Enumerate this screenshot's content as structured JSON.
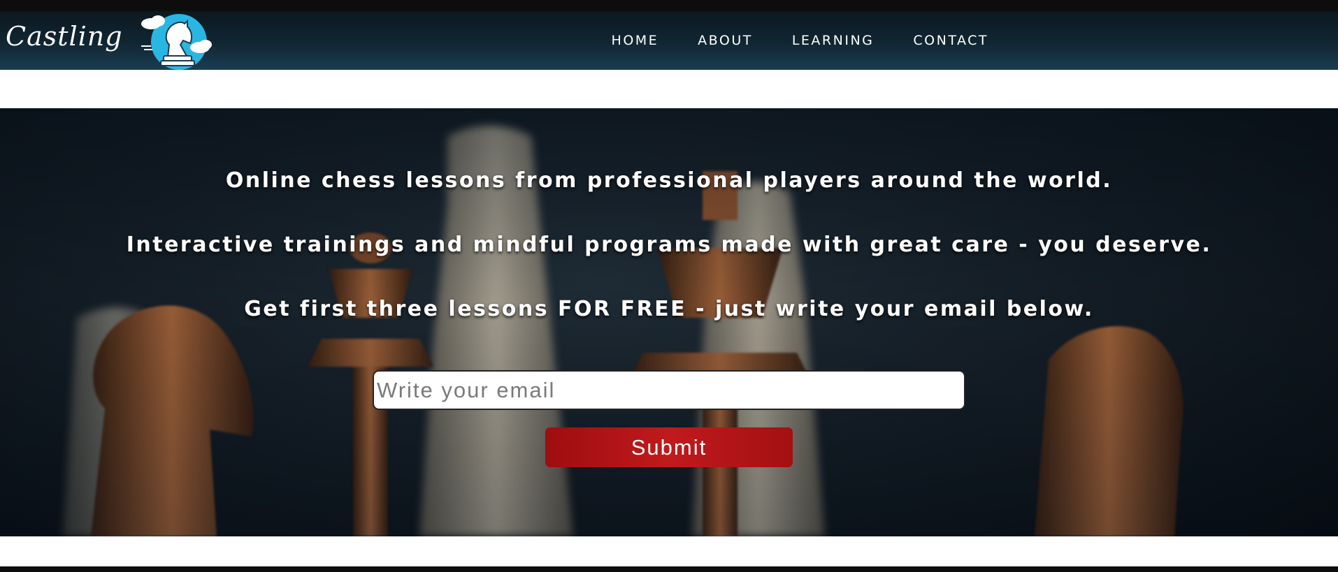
{
  "brand": {
    "name": "Castling",
    "emblem_icon": "cloud-knight-icon"
  },
  "nav": {
    "items": [
      {
        "label": "HOME"
      },
      {
        "label": "ABOUT"
      },
      {
        "label": "LEARNING"
      },
      {
        "label": "CONTACT"
      }
    ]
  },
  "hero": {
    "line1": "Online chess lessons from professional players around the world.",
    "line2": "Interactive trainings and mindful programs made with great care - you deserve.",
    "line3": "Get first three lessons FOR FREE - just write your email below.",
    "background": "chess-pieces-photo",
    "email": {
      "placeholder": "Write your email",
      "value": ""
    },
    "submit_label": "Submit"
  },
  "colors": {
    "header": "#112633",
    "submit": "#b31416",
    "emblem": "#29b6e3"
  }
}
